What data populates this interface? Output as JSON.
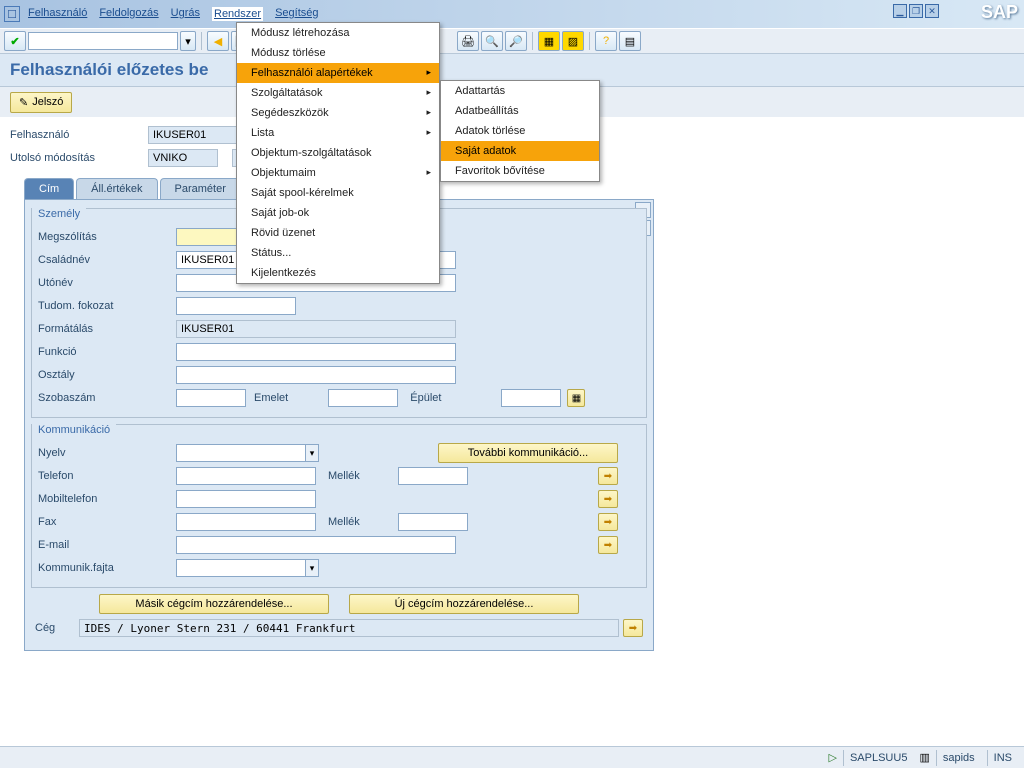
{
  "menubar": [
    "Felhasználó",
    "Feldolgozás",
    "Ugrás",
    "Rendszer",
    "Segítség"
  ],
  "page_title": "Felhasználói előzetes be",
  "btn_password": "Jelszó",
  "header_fields": {
    "user_label": "Felhasználó",
    "user_value": "IKUSER01",
    "lastmod_label": "Utolsó módosítás",
    "lastmod_value": "VNIKO",
    "lastmod_extra": "2"
  },
  "tabs": [
    "Cím",
    "Áll.értékek",
    "Paraméter"
  ],
  "group_person": {
    "title": "Személy",
    "salutation": "Megszólítás",
    "lastname": "Családnév",
    "lastname_val": "IKUSER01",
    "firstname": "Utónév",
    "acad": "Tudom. fokozat",
    "format": "Formátálás",
    "format_val": "IKUSER01",
    "function": "Funkció",
    "department": "Osztály",
    "room": "Szobaszám",
    "floor": "Emelet",
    "building": "Épület"
  },
  "group_comm": {
    "title": "Kommunikáció",
    "lang": "Nyelv",
    "more_comm": "További kommunikáció...",
    "phone": "Telefon",
    "ext": "Mellék",
    "mobile": "Mobiltelefon",
    "fax": "Fax",
    "email": "E-mail",
    "comm_type": "Kommunik.fajta"
  },
  "company_section": {
    "assign_other": "Másik cégcím hozzárendelése...",
    "assign_new": "Új cégcím hozzárendelése...",
    "company_label": "Cég",
    "company_value": "IDES / Lyoner Stern 231 / 60441 Frankfurt"
  },
  "menu1": [
    "Módusz létrehozása",
    "Módusz törlése",
    "Felhasználói alapértékek",
    "Szolgáltatások",
    "Segédeszközök",
    "Lista",
    "Objektum-szolgáltatások",
    "Objektumaim",
    "Saját spool-kérelmek",
    "Saját job-ok",
    "Rövid üzenet",
    "Státus...",
    "Kijelentkezés"
  ],
  "menu1_arrows": [
    2,
    3,
    4,
    5,
    7
  ],
  "menu2": [
    "Adattartás",
    "Adatbeállítás",
    "Adatok törlése",
    "Saját adatok",
    "Favoritok bővítése"
  ],
  "status": {
    "prog": "SAPLSUU5",
    "sys": "sapids",
    "mode": "INS"
  }
}
